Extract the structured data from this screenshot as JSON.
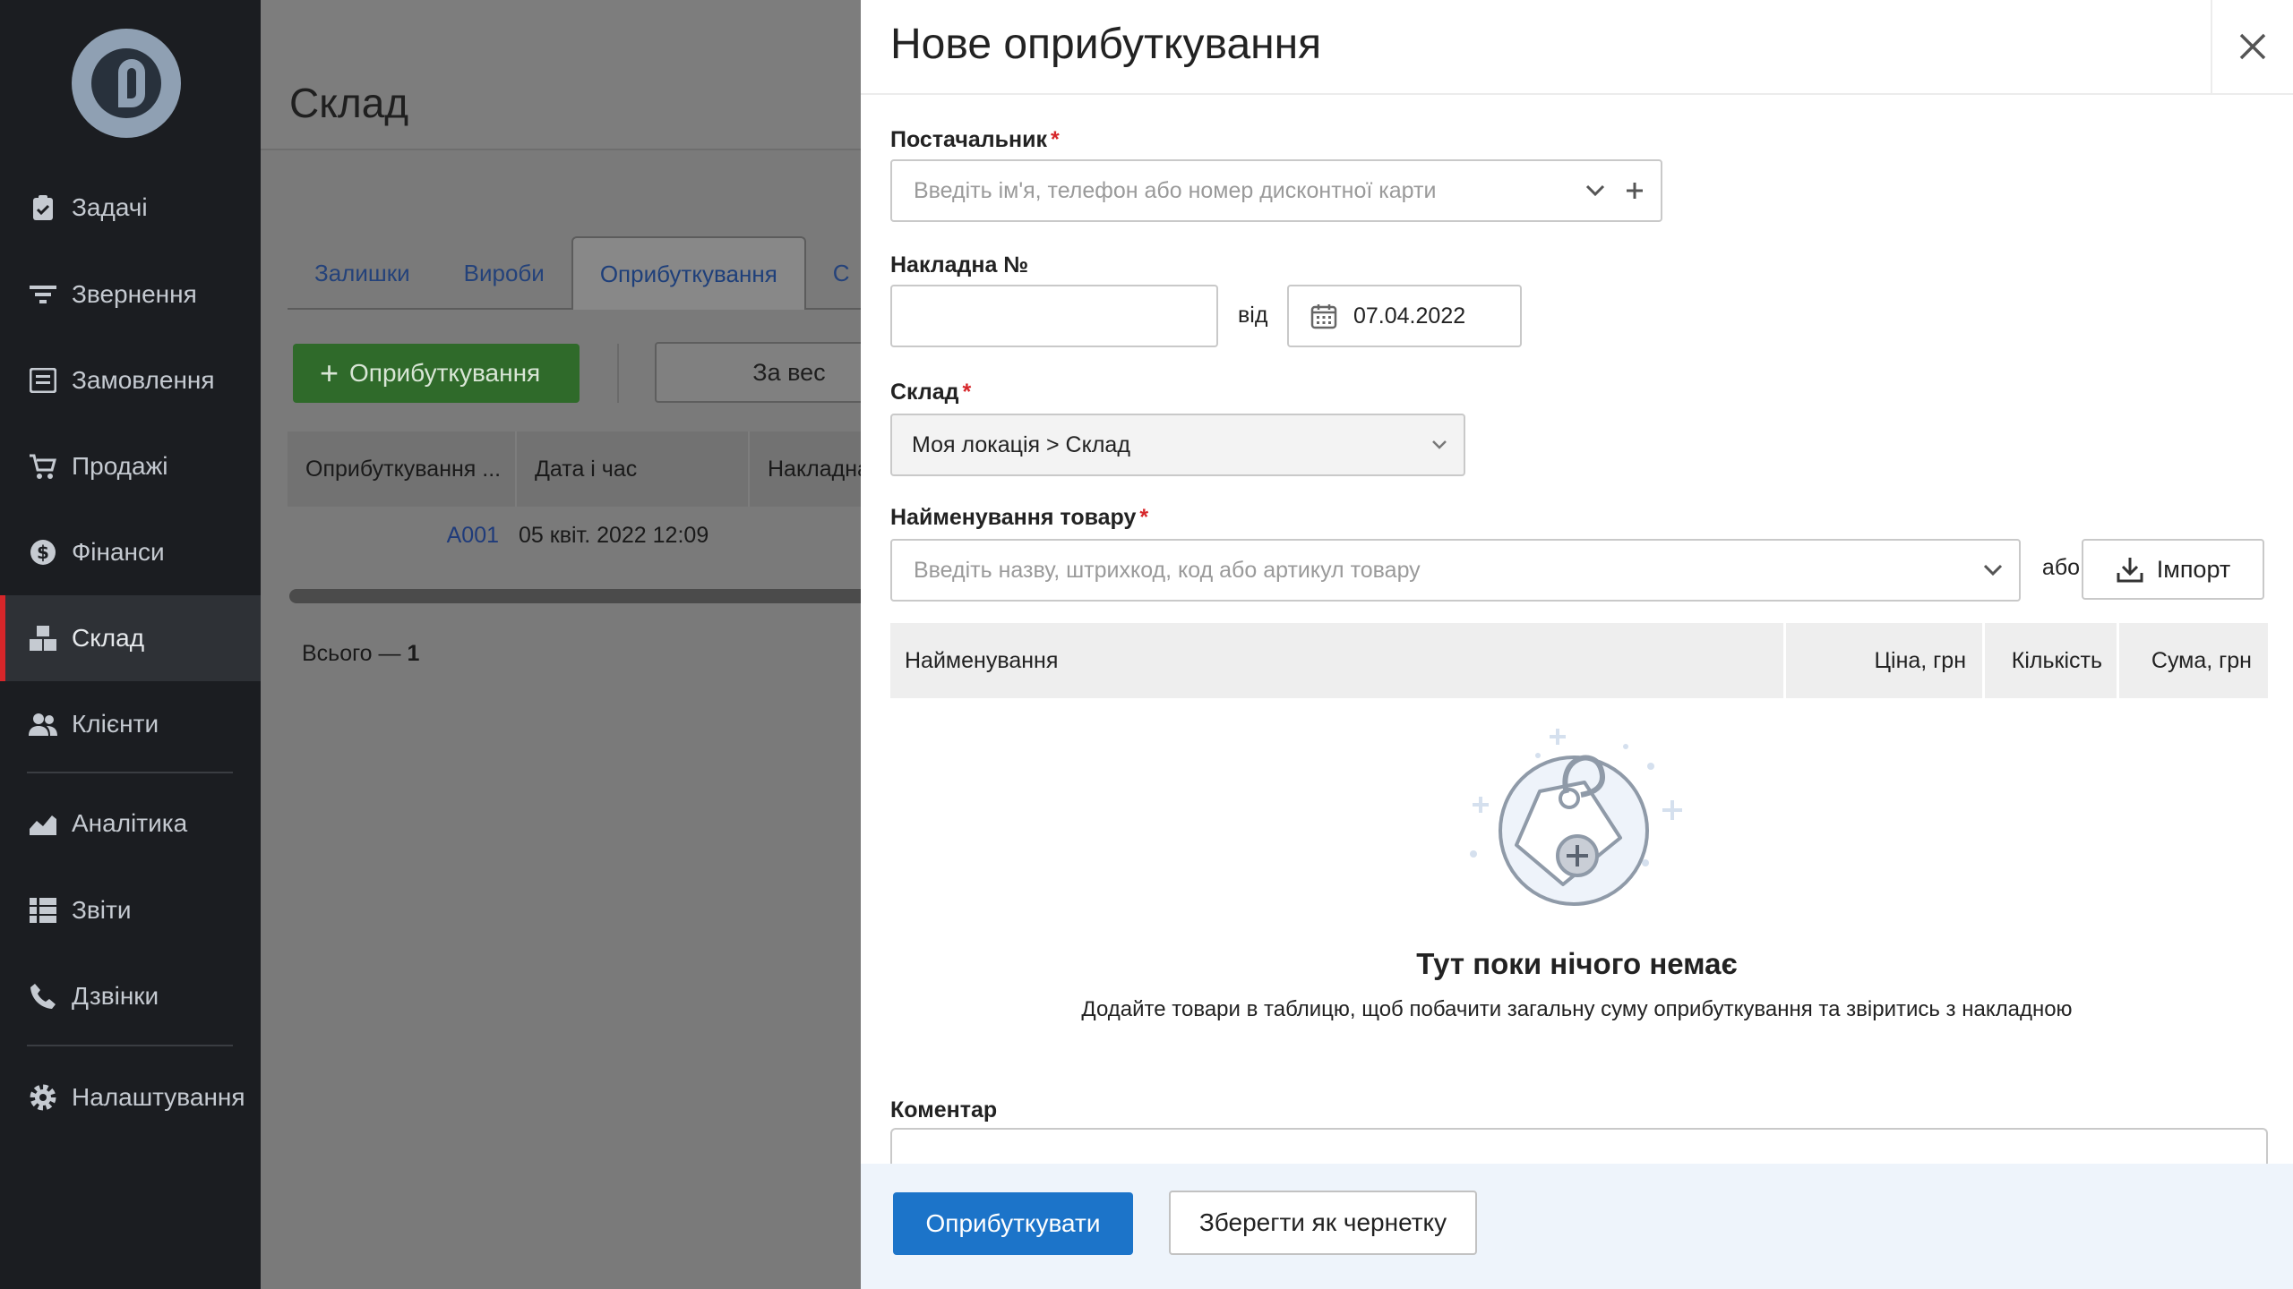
{
  "sidebar": {
    "items": [
      {
        "label": "Задачі",
        "icon": "clipboard-icon"
      },
      {
        "label": "Звернення",
        "icon": "filter-icon"
      },
      {
        "label": "Замовлення",
        "icon": "order-icon"
      },
      {
        "label": "Продажі",
        "icon": "cart-icon"
      },
      {
        "label": "Фінанси",
        "icon": "dollar-icon"
      },
      {
        "label": "Склад",
        "icon": "boxes-icon"
      },
      {
        "label": "Клієнти",
        "icon": "users-icon"
      },
      {
        "label": "Аналітика",
        "icon": "chart-icon"
      },
      {
        "label": "Звіти",
        "icon": "list-icon"
      },
      {
        "label": "Дзвінки",
        "icon": "phone-icon"
      },
      {
        "label": "Налаштування",
        "icon": "gear-icon"
      }
    ],
    "active": "Склад"
  },
  "main": {
    "title": "Склад",
    "tabs": [
      "Залишки",
      "Вироби",
      "Оприбуткування",
      "С"
    ],
    "add_button": "Оприбуткування",
    "filter_button": "За вес",
    "table": {
      "columns": [
        "Оприбуткування ...",
        "Дата і час",
        "Накладна"
      ],
      "rows": [
        {
          "code": "A001",
          "date": "05 квіт. 2022 12:09"
        }
      ]
    },
    "total_label": "Всього —",
    "total_count": "1"
  },
  "drawer": {
    "title": "Нове оприбуткування",
    "supplier": {
      "label": "Постачальник",
      "placeholder": "Введіть ім'я, телефон або номер дисконтної карти"
    },
    "invoice": {
      "label": "Накладна №",
      "value": "",
      "from_label": "від",
      "date": "07.04.2022"
    },
    "warehouse": {
      "label": "Склад",
      "value": "Моя локація > Склад"
    },
    "product": {
      "label": "Найменування товару",
      "placeholder": "Введіть назву, штрихкод, код або артикул товару",
      "or_label": "або",
      "import_label": "Імпорт"
    },
    "items_table": {
      "columns": [
        "Найменування",
        "Ціна, грн",
        "Кількість",
        "Сума, грн"
      ]
    },
    "empty": {
      "title": "Тут поки нічого немає",
      "subtitle": "Додайте товари в таблицю, щоб побачити загальну суму оприбуткування та звіритись з накладною"
    },
    "comment_label": "Коментар",
    "footer": {
      "submit": "Оприбуткувати",
      "draft": "Зберегти як чернетку"
    }
  },
  "colors": {
    "accent": "#1c74c9",
    "required": "#d6262a",
    "active_marker": "#d6262a",
    "add_green": "#2f6a2a"
  }
}
